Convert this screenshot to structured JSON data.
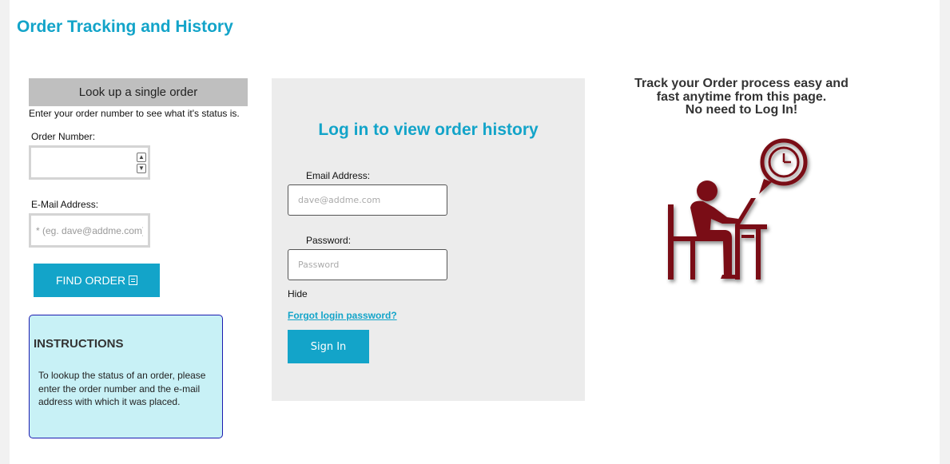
{
  "page": {
    "title": "Order Tracking and History"
  },
  "lookup": {
    "header": "Look up a single order",
    "description": "Enter your order number to see what it's status is.",
    "order_number_label": "Order Number:",
    "order_number_value": "",
    "email_label": "E-Mail Address:",
    "email_placeholder": "* (eg. dave@addme.com)",
    "find_button": "FIND ORDER"
  },
  "instructions": {
    "title": "INSTRUCTIONS",
    "body": "To lookup the status of an order, please enter the order number and the e-mail address with which it was placed."
  },
  "login": {
    "title": "Log in to view order history",
    "email_label": "Email Address:",
    "email_placeholder": "dave@addme.com",
    "password_label": "Password:",
    "password_placeholder": "Password",
    "hide_label": "Hide",
    "forgot_link": "Forgot login password?",
    "signin_button": "Sign In"
  },
  "promo": {
    "line1": "Track your Order process easy and",
    "line2": "fast anytime from this page.",
    "line3": "No need to Log In!"
  },
  "colors": {
    "accent": "#13a4c9",
    "illustration": "#7a1015",
    "instructions_bg": "#c8f1f6"
  },
  "icons": {
    "find_button_icon": "list-icon",
    "illustration": "person-at-laptop-clock-icon"
  }
}
